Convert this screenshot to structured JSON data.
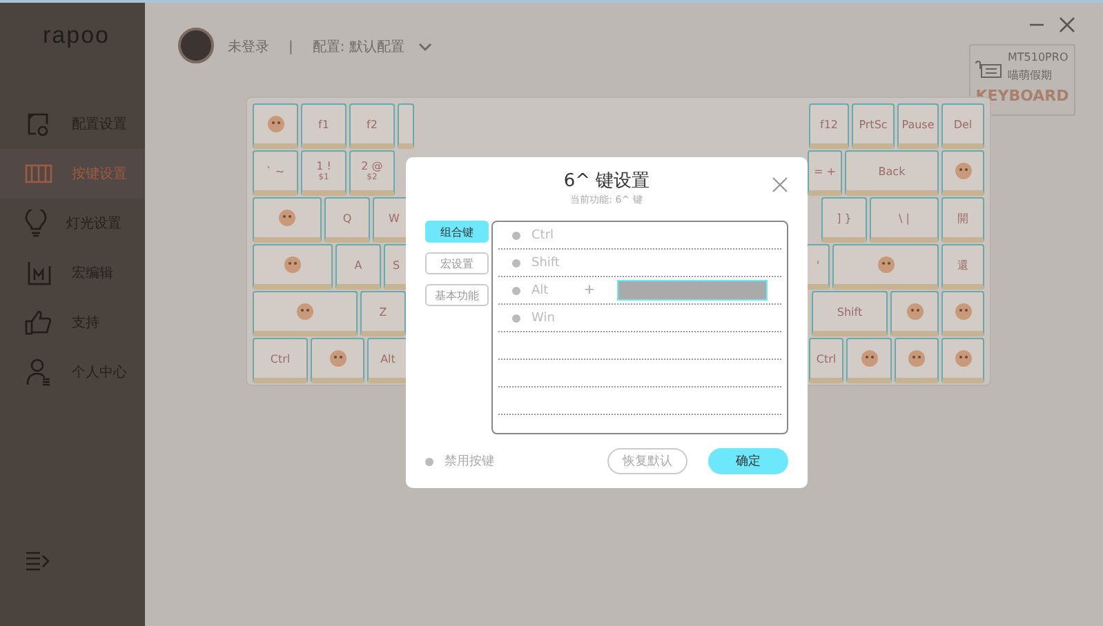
{
  "sidebar": {
    "logo": "rapoo",
    "items": [
      {
        "label": "配置设置",
        "selected": false
      },
      {
        "label": "按键设置",
        "selected": true
      },
      {
        "label": "灯光设置",
        "selected": false
      },
      {
        "label": "宏编辑",
        "selected": false
      },
      {
        "label": "支持",
        "selected": false
      },
      {
        "label": "个人中心",
        "selected": false
      }
    ]
  },
  "header": {
    "user": "未登录",
    "separator": "|",
    "profile": "配置: 默认配置"
  },
  "device": {
    "model": "MT510PRO",
    "name": "喵萌假期",
    "tag": "KEYBOARD"
  },
  "keyboard": {
    "rows": [
      {
        "left": [
          {
            "kind": "art"
          },
          {
            "kind": "text",
            "label": "f1"
          },
          {
            "kind": "text",
            "label": "f2"
          },
          {
            "kind": "blank"
          }
        ],
        "right": [
          {
            "kind": "text",
            "label": "f12"
          },
          {
            "kind": "text",
            "label": "PrtSc"
          },
          {
            "kind": "text",
            "label": "Pause"
          },
          {
            "kind": "text",
            "label": "Del"
          }
        ]
      },
      {
        "left": [
          {
            "kind": "text",
            "label": "` ~"
          },
          {
            "kind": "text",
            "label": "1 !",
            "sub": "$1"
          },
          {
            "kind": "text",
            "label": "2 @",
            "sub": "$2"
          }
        ],
        "right": [
          {
            "kind": "text",
            "label": "= +"
          },
          {
            "kind": "text",
            "label": "Back"
          },
          {
            "kind": "art"
          }
        ]
      },
      {
        "left": [
          {
            "kind": "art"
          },
          {
            "kind": "text",
            "label": "Q"
          },
          {
            "kind": "text",
            "label": "W"
          }
        ],
        "right": [
          {
            "kind": "text",
            "label": "] }"
          },
          {
            "kind": "text",
            "label": "\\ |"
          },
          {
            "kind": "text",
            "label": "開"
          }
        ]
      },
      {
        "left": [
          {
            "kind": "art"
          },
          {
            "kind": "text",
            "label": "A"
          },
          {
            "kind": "text",
            "label": "S"
          }
        ],
        "right": [
          {
            "kind": "text",
            "label": "'"
          },
          {
            "kind": "art"
          },
          {
            "kind": "text",
            "label": "還"
          }
        ]
      },
      {
        "left": [
          {
            "kind": "art"
          },
          {
            "kind": "text",
            "label": "Z"
          }
        ],
        "right": [
          {
            "kind": "text",
            "label": "Shift"
          },
          {
            "kind": "art"
          },
          {
            "kind": "art"
          }
        ]
      },
      {
        "left": [
          {
            "kind": "text",
            "label": "Ctrl"
          },
          {
            "kind": "art"
          },
          {
            "kind": "text",
            "label": "Alt"
          }
        ],
        "right": [
          {
            "kind": "text",
            "label": "Ctrl"
          },
          {
            "kind": "art"
          },
          {
            "kind": "art"
          },
          {
            "kind": "art"
          }
        ]
      }
    ]
  },
  "dialog": {
    "title": "6^ 键设置",
    "subtitle": "当前功能: 6^ 键",
    "tabs": [
      {
        "label": "组合键",
        "selected": true
      },
      {
        "label": "宏设置",
        "selected": false
      },
      {
        "label": "基本功能",
        "selected": false
      }
    ],
    "modifiers": [
      {
        "label": "Ctrl",
        "checked": false
      },
      {
        "label": "Shift",
        "checked": false
      },
      {
        "label": "Alt",
        "checked": false
      },
      {
        "label": "Win",
        "checked": false
      }
    ],
    "plus": "+",
    "disable": {
      "label": "禁用按键",
      "checked": false
    },
    "reset": "恢复默认",
    "confirm": "确定"
  }
}
